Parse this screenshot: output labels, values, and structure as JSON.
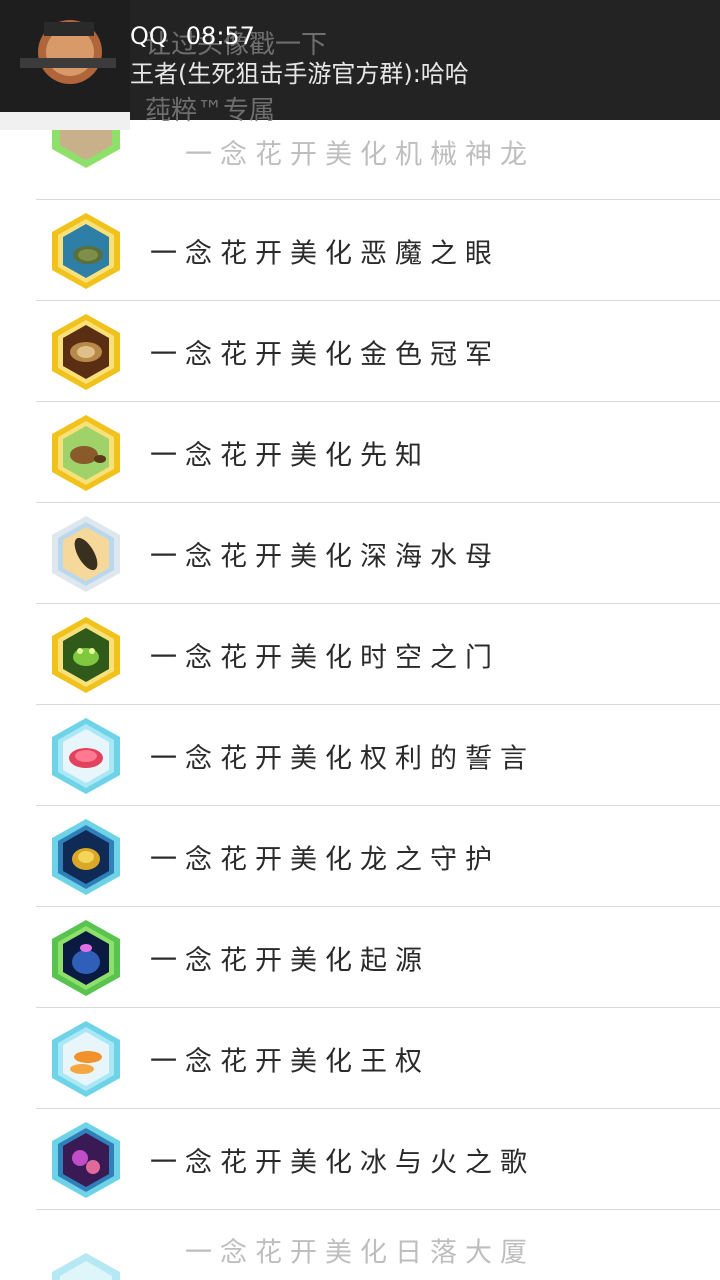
{
  "notification": {
    "app": "QQ",
    "time": "08:57",
    "message": "王者(生死狙击手游官方群):哈哈",
    "behind_line1": "让过头像戳一下",
    "behind_line2": "莼粹™专属"
  },
  "list": {
    "items": [
      {
        "label": "一念花开美化机械神龙",
        "icon": "green-hexagon-icon"
      },
      {
        "label": "一念花开美化恶魔之眼",
        "icon": "sea-turtle-icon"
      },
      {
        "label": "一念花开美化金色冠军",
        "icon": "tortoise-icon"
      },
      {
        "label": "一念花开美化先知",
        "icon": "turtle-icon"
      },
      {
        "label": "一念花开美化深海水母",
        "icon": "catfish-icon"
      },
      {
        "label": "一念花开美化时空之门",
        "icon": "frog-icon"
      },
      {
        "label": "一念花开美化权利的誓言",
        "icon": "coral-icon"
      },
      {
        "label": "一念花开美化龙之守护",
        "icon": "yellow-coral-icon"
      },
      {
        "label": "一念花开美化起源",
        "icon": "jellyfish-icon"
      },
      {
        "label": "一念花开美化王权",
        "icon": "mushroom-icon"
      },
      {
        "label": "一念花开美化冰与火之歌",
        "icon": "cells-icon"
      },
      {
        "label": "一念花开美化日落大厦",
        "icon": "teal-hexagon-icon"
      }
    ]
  },
  "colors": {
    "notification_bg": "#232323",
    "divider": "#d9d9d9",
    "text": "#2b2b2b",
    "gold_frame": "#f2c200",
    "blue_frame": "#6fd3e8",
    "green_frame": "#59c34f"
  }
}
